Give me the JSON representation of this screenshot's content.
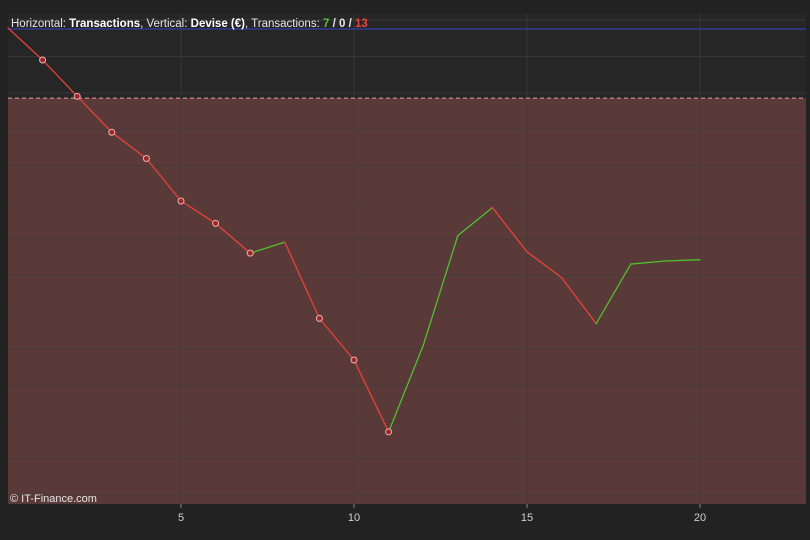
{
  "header": {
    "horizontal_label": "Horizontal:",
    "horizontal_value": "Transactions",
    "vertical_label": "Vertical:",
    "vertical_value": "Devise (€)",
    "transactions_label": "Transactions:",
    "count_wins": "7",
    "count_neutral": "0",
    "count_losses": "13",
    "sep1": ", ",
    "sep2": ", ",
    "slash": " / "
  },
  "copyright": "© IT-Finance.com",
  "colors": {
    "background": "#222222",
    "plot_background": "#262626",
    "drawdown_fill": "#5a3a38",
    "grid": "#3c3c3c",
    "win_segment": "#4fc02e",
    "loss_segment": "#e8403a",
    "reference_line": "#3344cc",
    "threshold_line": "#e89a9a",
    "marker_fill": "#9a2a2a",
    "marker_stroke": "#f0b0b0"
  },
  "chart_data": {
    "type": "line",
    "title": "",
    "xlabel": "Transactions",
    "ylabel": "Devise (€)",
    "xlim": [
      0,
      23
    ],
    "ylim": [
      0,
      100
    ],
    "x_ticks": [
      5,
      10,
      15,
      20
    ],
    "x_tick_labels": [
      "5",
      "10",
      "15",
      "20"
    ],
    "grid": true,
    "x": [
      0,
      1,
      2,
      3,
      4,
      5,
      6,
      7,
      8,
      9,
      10,
      11,
      12,
      13,
      14,
      15,
      16,
      17,
      18,
      19,
      20
    ],
    "values": [
      100,
      92.7,
      84.4,
      76.2,
      70.2,
      60.5,
      55.4,
      48.6,
      51.1,
      33.7,
      24.2,
      7.8,
      27.5,
      52.6,
      59.0,
      48.9,
      43.0,
      32.5,
      46.1,
      46.8,
      47.1
    ],
    "trade_results": [
      "loss",
      "loss",
      "loss",
      "loss",
      "loss",
      "loss",
      "loss",
      "win",
      "loss",
      "loss",
      "loss",
      "win",
      "win",
      "win",
      "loss",
      "loss",
      "loss",
      "win",
      "win",
      "win"
    ],
    "markers_at_x": [
      1,
      2,
      3,
      4,
      5,
      6,
      7,
      9,
      10,
      11
    ],
    "reference_level": 100,
    "drawdown_level": 84.0
  }
}
